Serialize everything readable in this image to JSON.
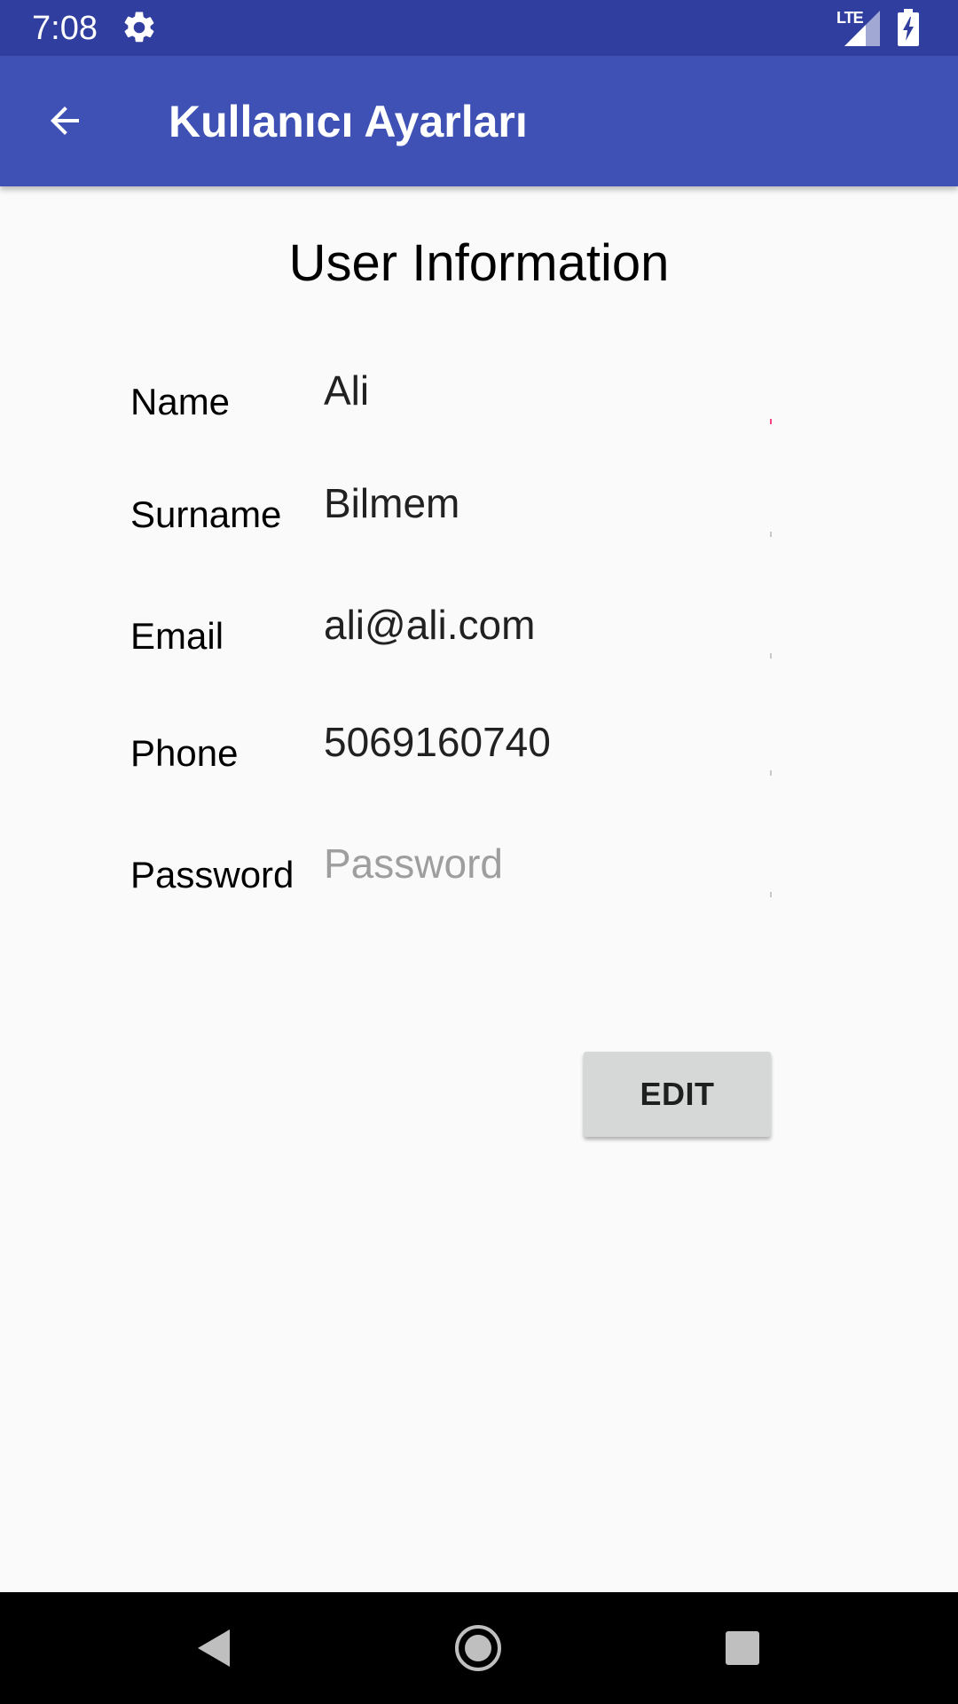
{
  "status_bar": {
    "time": "7:08",
    "network": "LTE",
    "icons": [
      "gear-icon",
      "signal-icon",
      "battery-charging-icon"
    ]
  },
  "app_bar": {
    "title": "Kullanıcı Ayarları",
    "back_icon": "arrow-back-icon"
  },
  "main": {
    "heading": "User Information",
    "fields": [
      {
        "label": "Name",
        "value": "Ali"
      },
      {
        "label": "Surname",
        "value": "Bilmem"
      },
      {
        "label": "Email",
        "value": "ali@ali.com"
      },
      {
        "label": "Phone",
        "value": "5069160740"
      },
      {
        "label": "Password",
        "value": "",
        "placeholder": "Password"
      }
    ],
    "edit_label": "EDIT"
  },
  "nav_bar": {
    "icons": [
      "back-triangle-icon",
      "home-circle-icon",
      "recents-square-icon"
    ]
  },
  "colors": {
    "status_bar": "#303f9f",
    "app_bar": "#3f51b5",
    "background": "#fafafa",
    "accent": "#ff4081",
    "button": "#d6d7d7"
  }
}
